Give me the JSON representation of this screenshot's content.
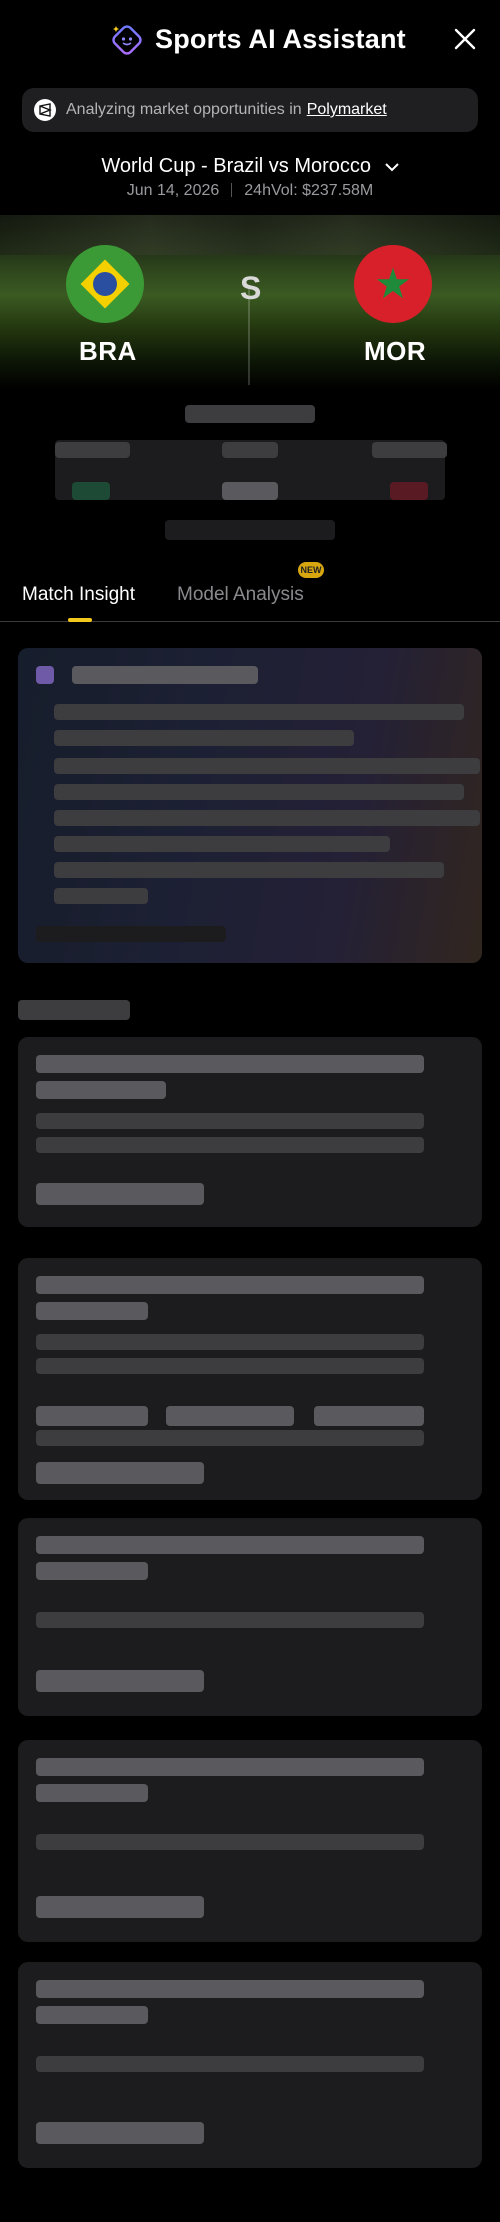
{
  "header": {
    "title": "Sports AI Assistant",
    "logo_icon": "sparkle-bot-icon",
    "close_icon": "close-icon"
  },
  "banner": {
    "text": "Analyzing market opportunities in",
    "link": "Polymarket",
    "icon": "polymarket-icon"
  },
  "match": {
    "title": "World Cup - Brazil vs Morocco",
    "date": "Jun 14, 2026",
    "volume": "24hVol: $237.58M",
    "home": {
      "code": "BRA",
      "flag_icon": "brazil-flag-icon"
    },
    "away": {
      "code": "MOR",
      "flag_icon": "morocco-flag-icon"
    },
    "score_glyph": "S"
  },
  "tabs": {
    "insight": "Match Insight",
    "model": "Model Analysis",
    "badge": "NEW"
  },
  "colors": {
    "accent": "#f2c91c",
    "background": "#000000",
    "card": "#1c1c1e",
    "muted_text": "#9a9a9f"
  }
}
